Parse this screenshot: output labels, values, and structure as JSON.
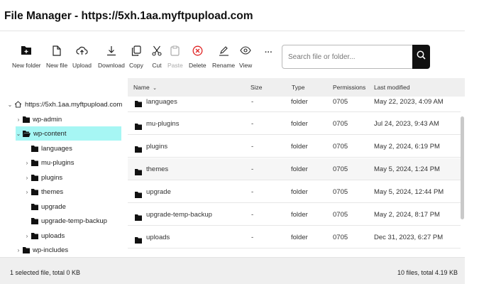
{
  "window": {
    "title": "File Manager - https://5xh.1aa.myftpupload.com"
  },
  "toolbar": {
    "new_folder": "New folder",
    "new_file": "New file",
    "upload": "Upload",
    "download": "Download",
    "copy": "Copy",
    "cut": "Cut",
    "paste": "Paste",
    "delete": "Delete",
    "rename": "Rename",
    "view": "View",
    "more": "···"
  },
  "search": {
    "placeholder": "Search file or folder..."
  },
  "tree": {
    "root": "https://5xh.1aa.myftpupload.com",
    "items": [
      {
        "label": "wp-admin"
      },
      {
        "label": "wp-content"
      },
      {
        "label": "languages"
      },
      {
        "label": "mu-plugins"
      },
      {
        "label": "plugins"
      },
      {
        "label": "themes"
      },
      {
        "label": "upgrade"
      },
      {
        "label": "upgrade-temp-backup"
      },
      {
        "label": "uploads"
      },
      {
        "label": "wp-includes"
      }
    ]
  },
  "table": {
    "headers": {
      "name": "Name",
      "sort": "⌄",
      "size": "Size",
      "type": "Type",
      "permissions": "Permissions",
      "modified": "Last modified"
    },
    "rows": [
      {
        "name": "languages",
        "size": "-",
        "type": "folder",
        "permissions": "0705",
        "modified": "May 22, 2023, 4:09 AM"
      },
      {
        "name": "mu-plugins",
        "size": "-",
        "type": "folder",
        "permissions": "0705",
        "modified": "Jul 24, 2023, 9:43 AM"
      },
      {
        "name": "plugins",
        "size": "-",
        "type": "folder",
        "permissions": "0705",
        "modified": "May 2, 2024, 6:19 PM"
      },
      {
        "name": "themes",
        "size": "-",
        "type": "folder",
        "permissions": "0705",
        "modified": "May 5, 2024, 1:24 PM"
      },
      {
        "name": "upgrade",
        "size": "-",
        "type": "folder",
        "permissions": "0705",
        "modified": "May 5, 2024, 12:44 PM"
      },
      {
        "name": "upgrade-temp-backup",
        "size": "-",
        "type": "folder",
        "permissions": "0705",
        "modified": "May 2, 2024, 8:17 PM"
      },
      {
        "name": "uploads",
        "size": "-",
        "type": "folder",
        "permissions": "0705",
        "modified": "Dec 31, 2023, 6:27 PM"
      }
    ]
  },
  "status": {
    "left": "1 selected file, total 0 KB",
    "right": "10 files, total 4.19 KB"
  },
  "colors": {
    "selected_tree_bg": "#a6f6f4",
    "delete_red": "#e02424",
    "search_button": "#111111"
  }
}
